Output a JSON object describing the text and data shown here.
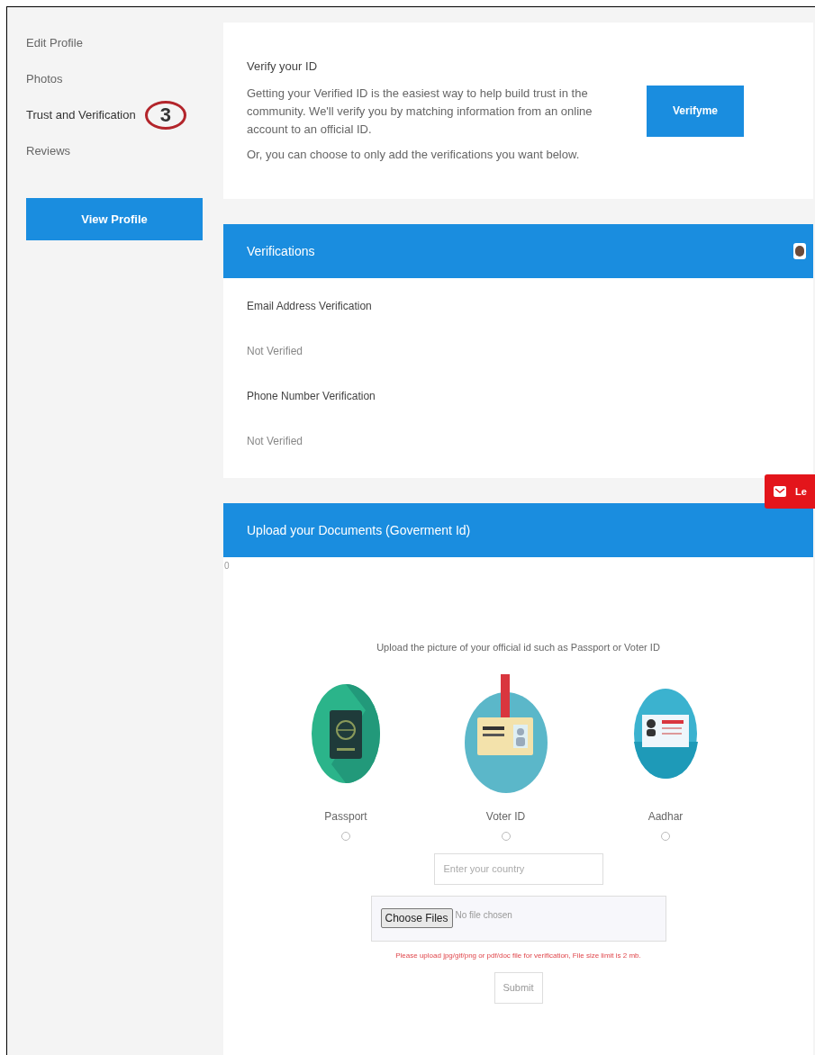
{
  "sidebar": {
    "items": [
      {
        "label": "Edit Profile",
        "selected": false
      },
      {
        "label": "Photos",
        "selected": false
      },
      {
        "label": "Trust and Verification",
        "selected": true
      },
      {
        "label": "Reviews",
        "selected": false
      }
    ],
    "annotation": "3",
    "button": "View Profile"
  },
  "verify_card": {
    "title": "Verify your ID",
    "text": "Getting your Verified ID is the easiest way to help build trust in the community. We'll verify you by matching information from an online account to an official ID.",
    "note": "Or, you can choose to only add the verifications you want below.",
    "button": "Verifyme"
  },
  "verifications": {
    "title": "Verifications",
    "items": [
      {
        "label": "Email Address Verification",
        "status": "Not Verified"
      },
      {
        "label": "Phone Number Verification",
        "status": "Not Verified"
      }
    ]
  },
  "feedback_tab": {
    "label": "Le"
  },
  "upload": {
    "title": "Upload your Documents (Goverment Id)",
    "counter": "0",
    "instruction": "Upload the picture of your official id such as Passport or Voter ID",
    "options": [
      {
        "kind": "passport",
        "label": "Passport",
        "selected": false
      },
      {
        "kind": "voter",
        "label": "Voter ID",
        "selected": false
      },
      {
        "kind": "aadhar",
        "label": "Aadhar",
        "selected": false
      }
    ],
    "country": {
      "placeholder": "Enter your country"
    },
    "file": {
      "button": "Choose Files",
      "status": "No file chosen"
    },
    "warning": "Please upload jpg/gif/png or pdf/doc file for verification, File size limit is 2 mb.",
    "submit": "Submit"
  }
}
